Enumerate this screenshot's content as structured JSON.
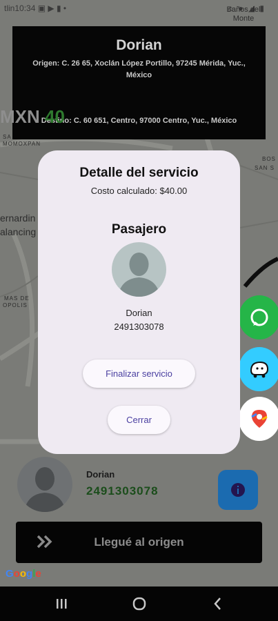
{
  "status_bar": {
    "time": "10:34",
    "left_text": "tlin",
    "icons": "▣ ▶ ▮ •",
    "right_icons": "⌂ ● ◢ ▮"
  },
  "map": {
    "labels": [
      "Baños del Monte",
      "SA",
      "MOMOXPAN",
      "BOS",
      "SAN S",
      "ernardin",
      "alancing",
      "MAS DE",
      "OPOLIS"
    ]
  },
  "trip": {
    "name": "Dorian",
    "origin": "Origen: C. 26 65, Xoclán López Portillo, 97245 Mérida, Yuc., México",
    "destination": "Destino: C. 60 651, Centro, 97000 Centro, Yuc., México",
    "currency": "MXN",
    "amount": "40"
  },
  "dialog": {
    "title": "Detalle del servicio",
    "cost": "Costo calculado: $40.00",
    "passenger_heading": "Pasajero",
    "passenger_name": "Dorian",
    "passenger_phone": "2491303078",
    "finish_label": "Finalizar servicio",
    "close_label": "Cerrar"
  },
  "driver_panel": {
    "name": "Dorian",
    "phone": "2491303078"
  },
  "arrive": {
    "label": "Llegué al origen"
  },
  "google": {
    "letters": [
      "G",
      "o",
      "o",
      "g",
      "l",
      "e"
    ]
  },
  "colors": {
    "accent": "#4a3fa0",
    "price_green": "#2f7a2f",
    "whatsapp": "#25b548",
    "waze": "#33ccff",
    "info_blue": "#1b6bb0"
  },
  "icons": {
    "whatsapp": "whatsapp-icon",
    "waze": "waze-icon",
    "maps": "google-maps-icon",
    "info": "info-icon",
    "avatar": "user-silhouette-icon"
  }
}
